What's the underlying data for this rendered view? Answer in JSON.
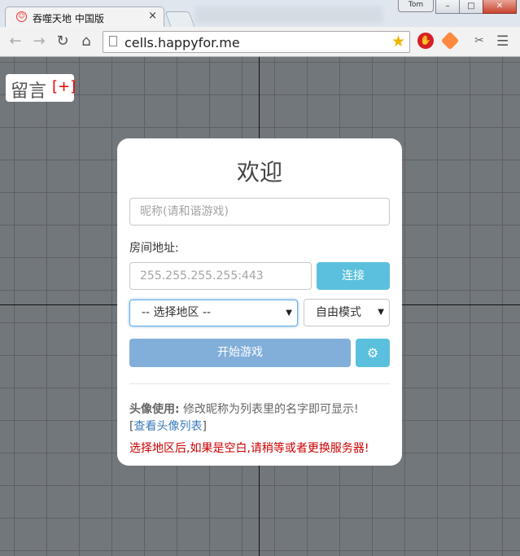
{
  "browser": {
    "tab_title": "吞噬天地 中国版",
    "tab_close": "×",
    "user_badge": "Tom",
    "window_buttons": {
      "minimize": "–",
      "maximize": "□",
      "close": "✕"
    },
    "address": "cells.happyfor.me",
    "icons": [
      "back-icon",
      "forward-icon",
      "reload-icon",
      "home-icon",
      "page-icon",
      "star-icon",
      "adblock-icon",
      "extension-icon",
      "scissors-icon",
      "menu-icon"
    ]
  },
  "page": {
    "comment": {
      "label": "留言",
      "add": "[+]"
    },
    "panel": {
      "title": "欢迎",
      "nickname_placeholder": "昵称(请和谐游戏)",
      "room_label": "房间地址:",
      "room_placeholder": "255.255.255.255:443",
      "connect_label": "连接",
      "region_selected": "-- 选择地区 --",
      "mode_selected": "自由模式",
      "start_label": "开始游戏",
      "avatar_title": "头像使用:",
      "avatar_text": " 修改昵称为列表里的名字即可显示!",
      "avatar_link_open": "[",
      "avatar_link": "查看头像列表",
      "avatar_link_close": "]",
      "warning": "选择地区后,如果是空白,请稍等或者更换服务器!"
    },
    "colors": {
      "accent_info": "#5bc0de",
      "start_button": "#82afda",
      "warning": "#cc0000",
      "background": "#72777b"
    }
  }
}
